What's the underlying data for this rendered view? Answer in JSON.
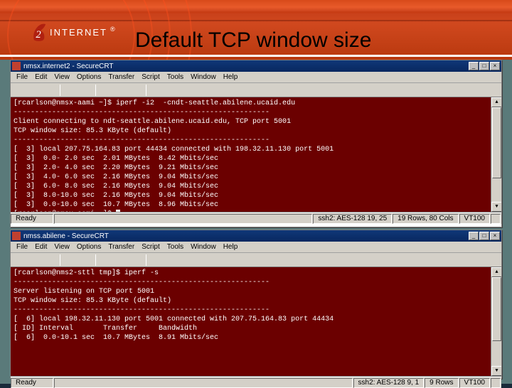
{
  "slide": {
    "title": "Default TCP window size"
  },
  "logo": {
    "text": "INTERNET",
    "reg": "®"
  },
  "win1": {
    "title": "nmsx.internet2 - SecureCRT",
    "menu": [
      "File",
      "Edit",
      "View",
      "Options",
      "Transfer",
      "Script",
      "Tools",
      "Window",
      "Help"
    ],
    "term": "[rcarlson@nmsx-aami ~]$ iperf -i2  -cndt-seattle.abilene.ucaid.edu\n------------------------------------------------------------\nClient connecting to ndt-seattle.abilene.ucaid.edu, TCP port 5001\nTCP window size: 85.3 KByte (default)\n------------------------------------------------------------\n[  3] local 207.75.164.83 port 44434 connected with 198.32.11.130 port 5001\n[  3]  0.0- 2.0 sec  2.01 MBytes  8.42 Mbits/sec\n[  3]  2.0- 4.0 sec  2.20 MBytes  9.21 Mbits/sec\n[  3]  4.0- 6.0 sec  2.16 MBytes  9.04 Mbits/sec\n[  3]  6.0- 8.0 sec  2.16 MBytes  9.04 Mbits/sec\n[  3]  8.0-10.0 sec  2.16 MBytes  9.04 Mbits/sec\n[  3]  0.0-10.0 sec  10.7 MBytes  8.96 Mbits/sec\n[rcarlson@nmsx-aami ~]$ ",
    "status": {
      "left": "Ready",
      "cells": [
        "ssh2: AES-128  19, 25",
        "19 Rows, 80 Cols",
        "VT100"
      ]
    }
  },
  "win2": {
    "title": "nmss.abilene - SecureCRT",
    "menu": [
      "File",
      "Edit",
      "View",
      "Options",
      "Transfer",
      "Script",
      "Tools",
      "Window",
      "Help"
    ],
    "term": "[rcarlson@nms2-sttl tmp]$ iperf -s\n------------------------------------------------------------\nServer listening on TCP port 5001\nTCP window size: 85.3 KByte (default)\n------------------------------------------------------------\n[  6] local 198.32.11.130 port 5001 connected with 207.75.164.83 port 44434\n[ ID] Interval       Transfer     Bandwidth\n[  6]  0.0-10.1 sec  10.7 MBytes  8.91 Mbits/sec",
    "status": {
      "left": "Ready",
      "cells": [
        "ssh2: AES-128  9, 1",
        "9 Rows",
        "VT100"
      ]
    }
  },
  "winbtn": {
    "min": "_",
    "max": "□",
    "close": "×"
  }
}
